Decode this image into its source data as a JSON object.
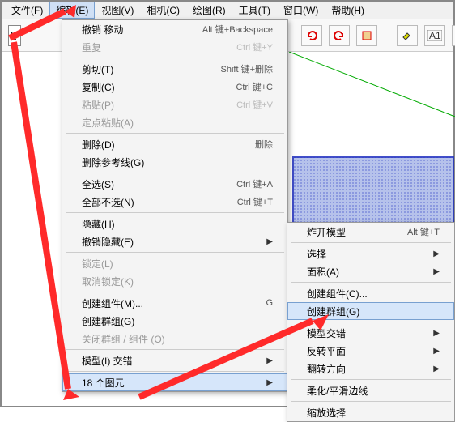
{
  "menubar": {
    "file": "文件(F)",
    "edit": "编辑(E)",
    "view": "视图(V)",
    "camera": "相机(C)",
    "draw": "绘图(R)",
    "tools": "工具(T)",
    "window": "窗口(W)",
    "help": "帮助(H)"
  },
  "edit_menu": {
    "undo": "撤销 移动",
    "undo_key": "Alt 键+Backspace",
    "redo": "重复",
    "redo_key": "Ctrl 键+Y",
    "cut": "剪切(T)",
    "cut_key": "Shift 键+删除",
    "copy": "复制(C)",
    "copy_key": "Ctrl 键+C",
    "paste": "粘贴(P)",
    "paste_key": "Ctrl 键+V",
    "paste_in_place": "定点粘贴(A)",
    "delete": "删除(D)",
    "delete_key": "删除",
    "delete_guides": "删除参考线(G)",
    "select_all": "全选(S)",
    "select_all_key": "Ctrl 键+A",
    "select_none": "全部不选(N)",
    "select_none_key": "Ctrl 键+T",
    "hide": "隐藏(H)",
    "unhide": "撤销隐藏(E)",
    "lock": "锁定(L)",
    "unlock": "取消锁定(K)",
    "make_component": "创建组件(M)...",
    "make_component_key": "G",
    "make_group": "创建群组(G)",
    "close_group": "关闭群组 / 组件 (O)",
    "intersect": "模型(I) 交错",
    "entities": "18 个图元"
  },
  "submenu": {
    "explode": "炸开模型",
    "explode_key": "Alt 键+T",
    "select": "选择",
    "area": "面积(A)",
    "make_component": "创建组件(C)...",
    "make_group": "创建群组(G)",
    "intersect": "模型交错",
    "flip_along": "反转平面",
    "flip_direction": "翻转方向",
    "soften": "柔化/平滑边线",
    "zoom": "缩放选择"
  },
  "icons": {
    "cursor": "↖",
    "redo": "↻",
    "undo": "↺",
    "select": "⬚",
    "paint": "🪣",
    "text": "A",
    "measure": "📐"
  }
}
